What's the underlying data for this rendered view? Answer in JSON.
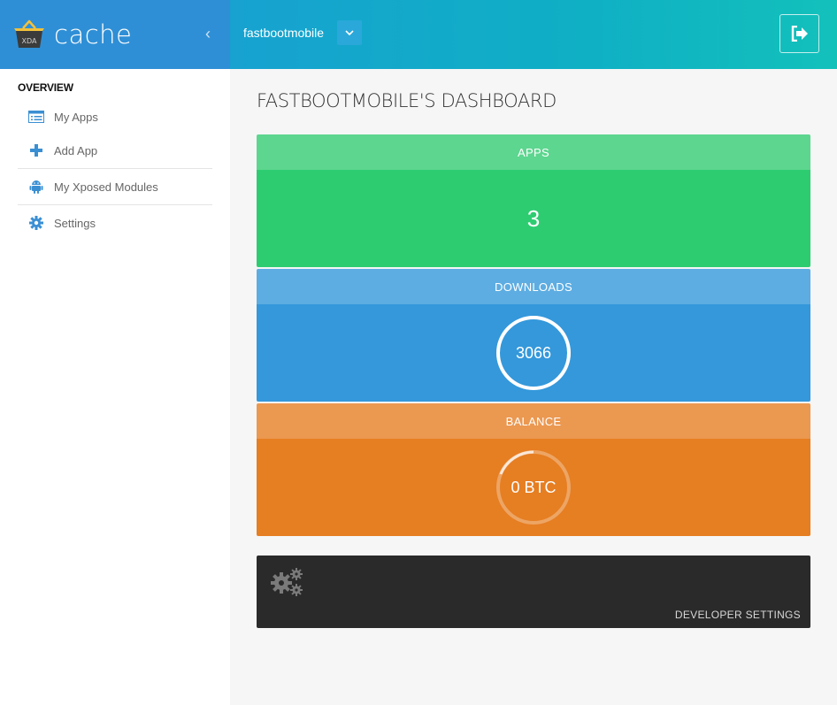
{
  "brand": {
    "name": "cache",
    "logo_text": "XDA",
    "collapse_glyph": "‹"
  },
  "header": {
    "username": "fastbootmobile",
    "dropdown_icon": "chevron-down-icon",
    "logout_icon": "sign-out-icon"
  },
  "sidebar": {
    "section_title": "OVERVIEW",
    "items": [
      {
        "label": "My Apps",
        "icon": "list-icon"
      },
      {
        "label": "Add App",
        "icon": "plus-icon"
      },
      {
        "label": "My Xposed Modules",
        "icon": "android-icon"
      },
      {
        "label": "Settings",
        "icon": "gear-icon"
      }
    ]
  },
  "main": {
    "page_title": "FASTBOOTMOBILE'S DASHBOARD",
    "apps": {
      "label": "APPS",
      "value": "3"
    },
    "downloads": {
      "label": "DOWNLOADS",
      "value": "3066",
      "progress": 1.0
    },
    "balance": {
      "label": "BALANCE",
      "value": "0 BTC",
      "progress": 0.0
    },
    "developer": {
      "label": "DEVELOPER SETTINGS",
      "icon": "gears-icon"
    }
  },
  "colors": {
    "sidebar_brand": "#2f8fd6",
    "header_gradient_start": "#17a2d0",
    "header_gradient_end": "#13c1bb",
    "apps": "#2ecc71",
    "downloads": "#3498db",
    "balance": "#e67e22",
    "developer": "#2a2a2a",
    "icon_blue": "#3a8fd3"
  }
}
